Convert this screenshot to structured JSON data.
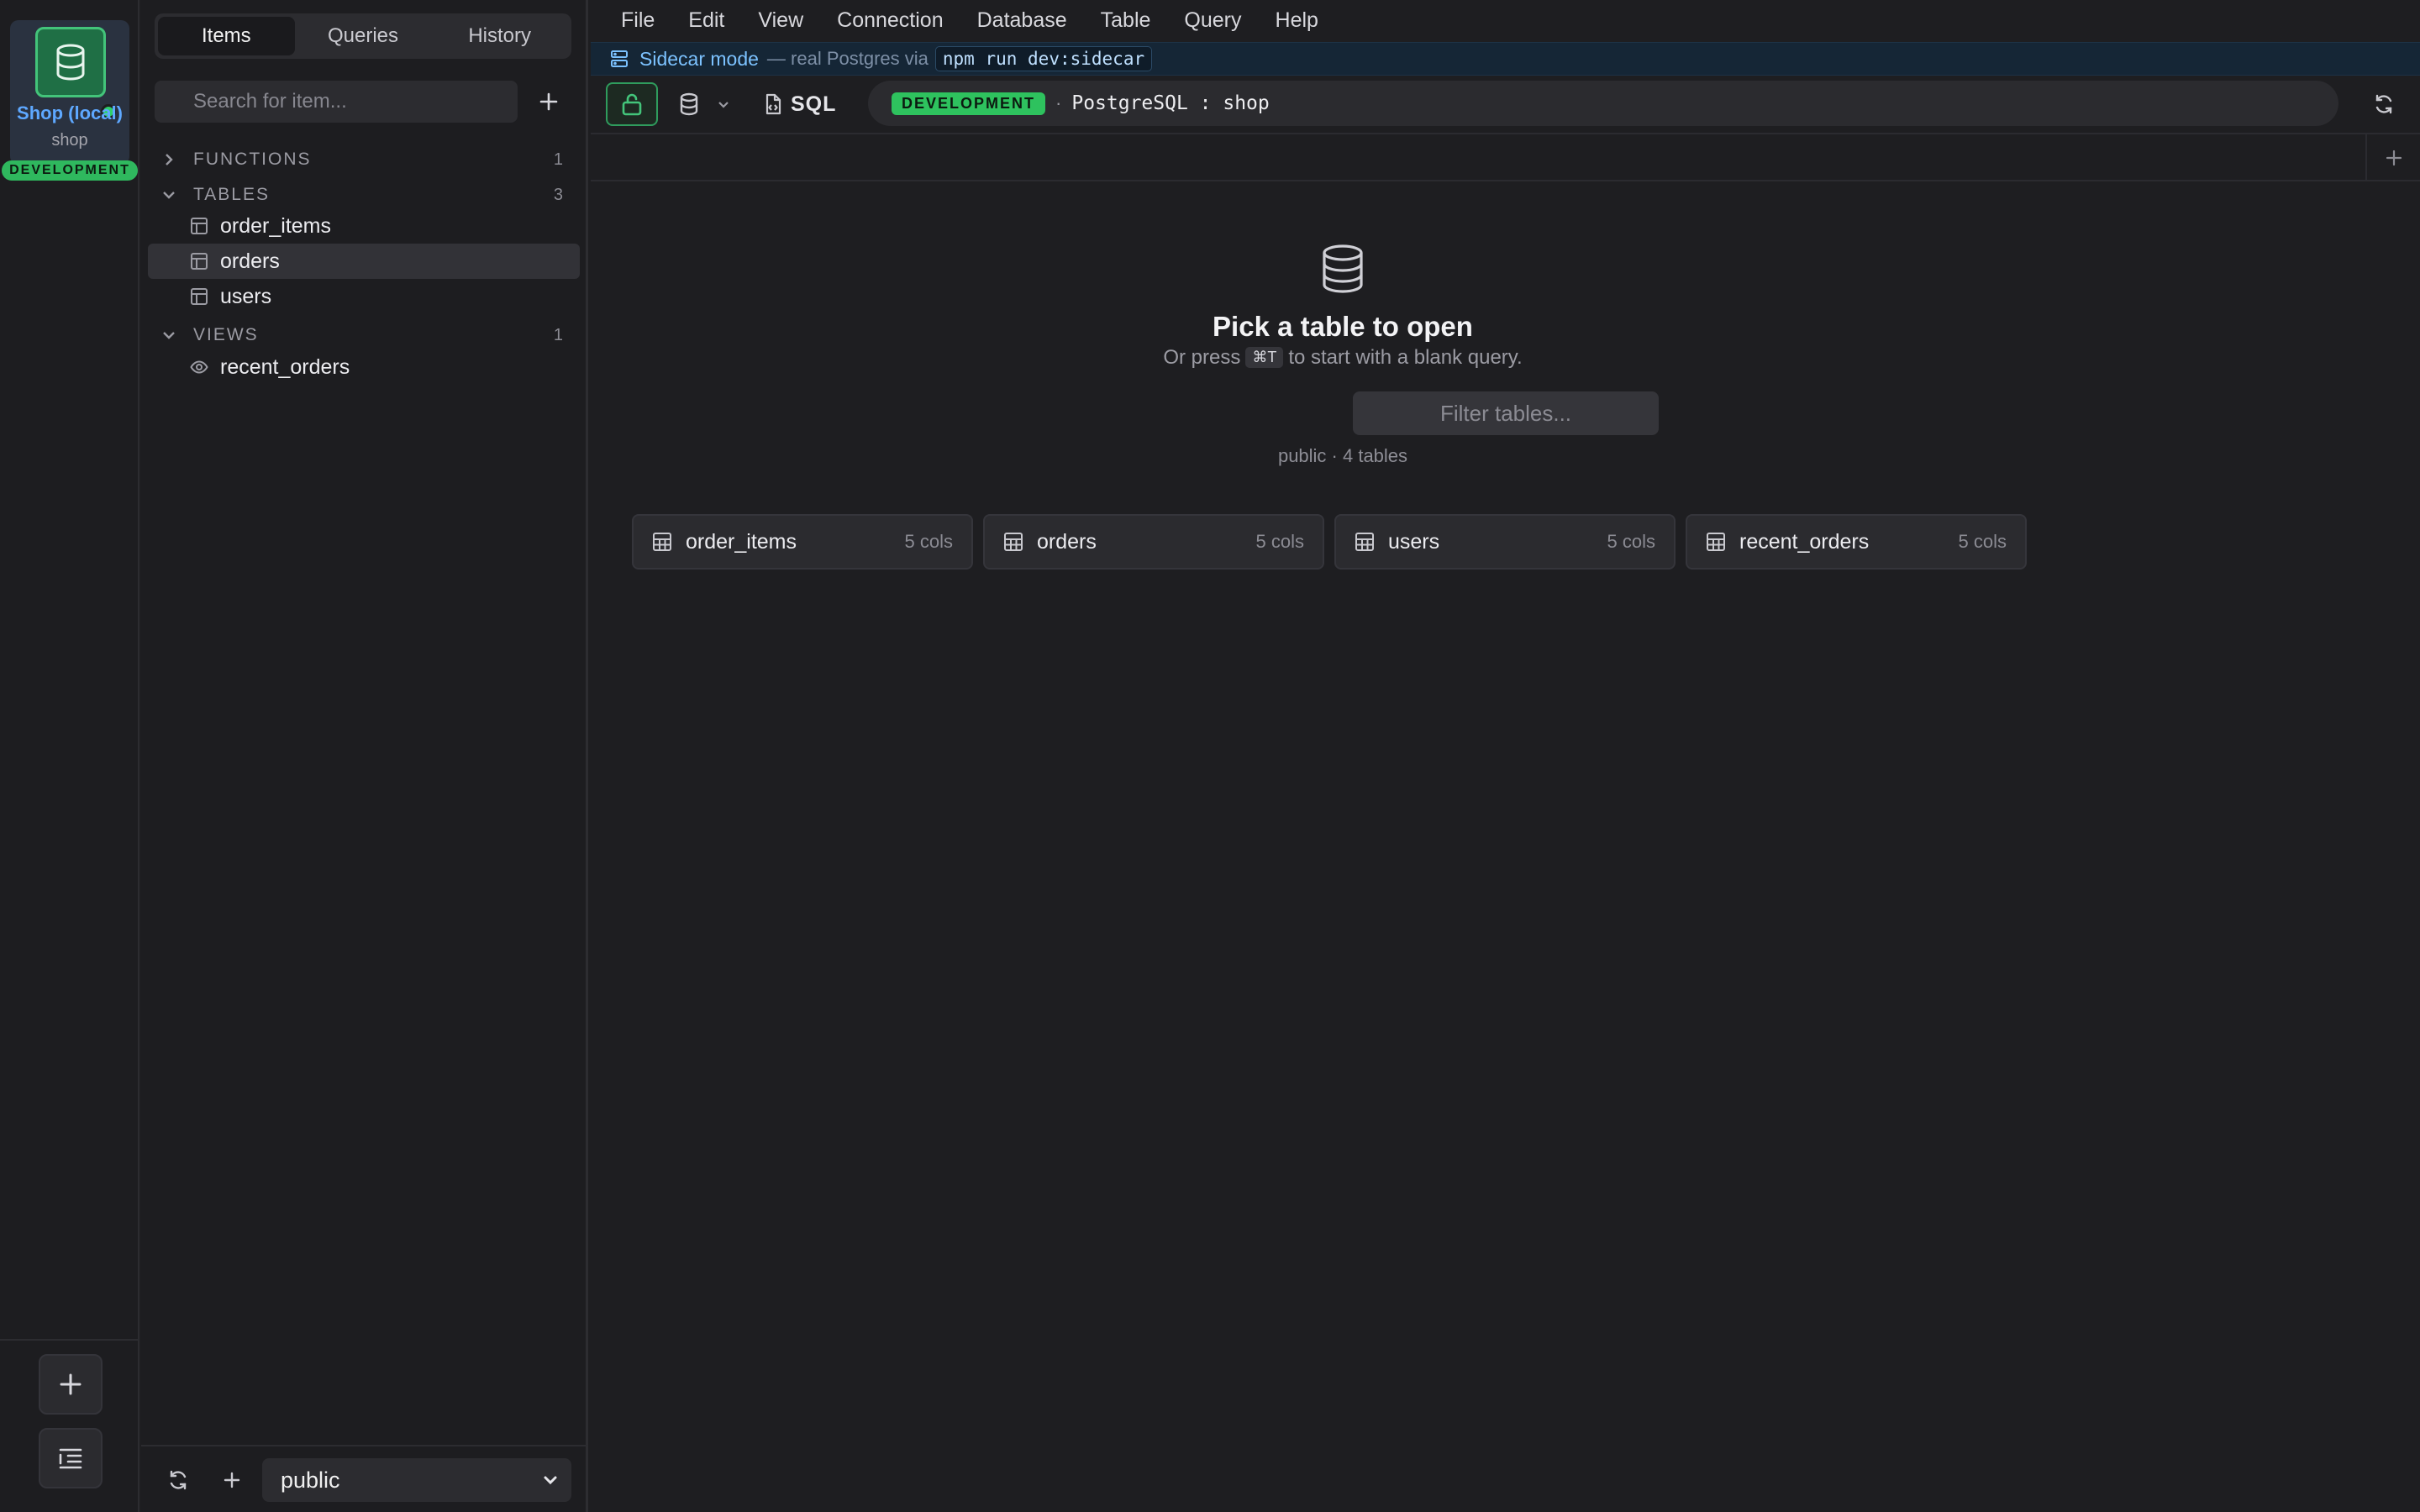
{
  "connection": {
    "name": "Shop (local)",
    "database": "shop",
    "environment": "DEVELOPMENT",
    "env_color": "#2fb85e",
    "accent_color": "#5ea8ff"
  },
  "rail": {
    "add_icon": "plus-icon",
    "manage_icon": "list-indent-icon"
  },
  "sidebar": {
    "tabs": [
      {
        "label": "Items",
        "active": true
      },
      {
        "label": "Queries",
        "active": false
      },
      {
        "label": "History",
        "active": false
      }
    ],
    "search_placeholder": "Search for item...",
    "sections": {
      "functions": {
        "label": "FUNCTIONS",
        "count": "1"
      },
      "tables": {
        "label": "TABLES",
        "count": "3"
      },
      "views": {
        "label": "VIEWS",
        "count": "1"
      }
    },
    "tables": [
      {
        "label": "order_items",
        "selected": false
      },
      {
        "label": "orders",
        "selected": true
      },
      {
        "label": "users",
        "selected": false
      }
    ],
    "views": [
      {
        "label": "recent_orders"
      }
    ],
    "schema": "public"
  },
  "menubar": [
    "File",
    "Edit",
    "View",
    "Connection",
    "Database",
    "Table",
    "Query",
    "Help"
  ],
  "banner": {
    "title": "Sidecar mode",
    "description": "— real Postgres via",
    "command": "npm run dev:sidecar"
  },
  "toolbar": {
    "sql_label": "SQL",
    "env_badge": "DEVELOPMENT",
    "separator": "·",
    "connection_label": "PostgreSQL : shop"
  },
  "empty_state": {
    "title": "Pick a table to open",
    "hint_prefix": "Or press",
    "shortcut": "⌘T",
    "hint_suffix": "to start with a blank query.",
    "filter_placeholder": "Filter tables...",
    "summary": "public · 4 tables",
    "cards": [
      {
        "name": "order_items",
        "cols": "5 cols"
      },
      {
        "name": "orders",
        "cols": "5 cols"
      },
      {
        "name": "users",
        "cols": "5 cols"
      },
      {
        "name": "recent_orders",
        "cols": "5 cols"
      }
    ]
  }
}
